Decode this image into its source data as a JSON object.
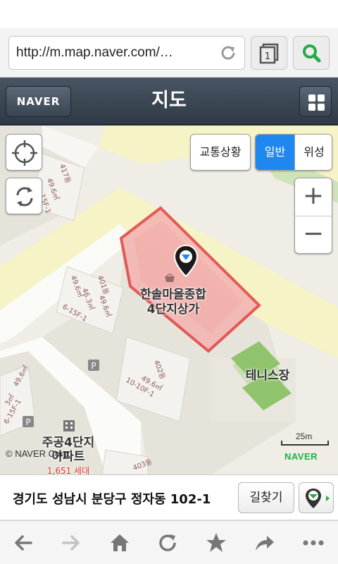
{
  "browser": {
    "url": "http://m.map.naver.com/…",
    "tab_count": "1"
  },
  "header": {
    "logo": "NAVER",
    "title": "지도"
  },
  "map": {
    "traffic_label": "교통상황",
    "type_normal_label": "일반",
    "type_satellite_label": "위성",
    "active_type": "일반",
    "zoom_in_label": "+",
    "zoom_out_label": "−",
    "poi_label_line1": "한솔마을종합",
    "poi_label_line2": "4단지상가",
    "tennis_label": "테니스장",
    "apt_label_line1": "주공4단지",
    "apt_label_line2": "아파트",
    "apt_households": "1,651 세대",
    "scale_label": "25m",
    "copyright": "© NAVER Corp.",
    "watermark": "NAVER",
    "building_labels": {
      "b417": "417동",
      "b417_area": "49.6㎡",
      "b417_floor": "15F-1",
      "b401": "401동",
      "b401_area1": "49.6㎡",
      "b401_area2": "46.3㎡",
      "b401_area3": "49.6㎡",
      "b401_floor": "6-15F-1",
      "b402": "402동",
      "b402_area": "49.6㎡",
      "b402_floor": "10-10F-1",
      "b403": "403동",
      "bleft_area": "49.6㎡",
      "bleft_area2": "3㎡",
      "bleft_floor": "6-15F-1"
    },
    "colors": {
      "road": "#f6f3c6",
      "block": "#e6e3da",
      "building": "#f4f2ee",
      "highlight_fill": "#f4b6b4",
      "highlight_stroke": "#e24a4a",
      "active_button": "#1e88f0",
      "tennis": "#c9dcb6"
    }
  },
  "address": {
    "text": "경기도 성남시 분당구 정자동 102-1",
    "route_label": "길찾기"
  }
}
